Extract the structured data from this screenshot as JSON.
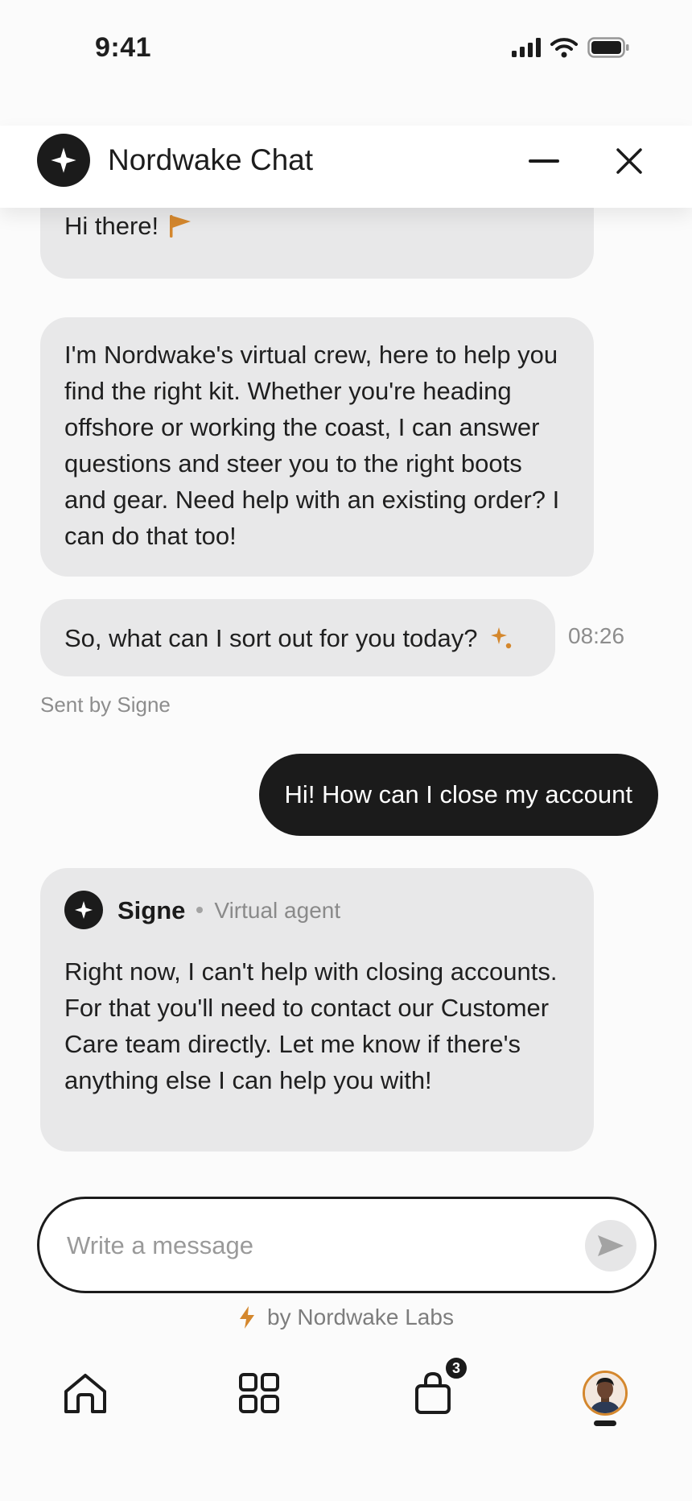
{
  "status_bar": {
    "time": "9:41"
  },
  "header": {
    "title": "Nordwake Chat",
    "minimize_icon": "minus-icon",
    "close_icon": "close-icon"
  },
  "messages": {
    "greeting": "Hi there!",
    "intro": "I'm Nordwake's virtual crew, here to help you find the right kit. Whether you're heading offshore or working the coast, I can answer questions and steer you to the right boots and gear. Need help with an existing order? I can do that too!",
    "prompt": "So, what can I sort out for you today?",
    "prompt_time": "08:26",
    "sent_by": "Sent by Signe",
    "user_message": "Hi! How can I close my account",
    "agent": {
      "name": "Signe",
      "role": "Virtual agent"
    },
    "agent_reply": "Right now, I can't help with closing accounts. For that you'll need to contact our Customer Care team directly. Let me know if there's anything else I can help you with!"
  },
  "composer": {
    "placeholder": "Write a message",
    "value": ""
  },
  "powered_by": "by Nordwake Labs",
  "nav": {
    "cart_count": "3"
  },
  "colors": {
    "accent": "#d4872d",
    "dark": "#1b1b1b",
    "bubble": "#e8e8e9"
  }
}
